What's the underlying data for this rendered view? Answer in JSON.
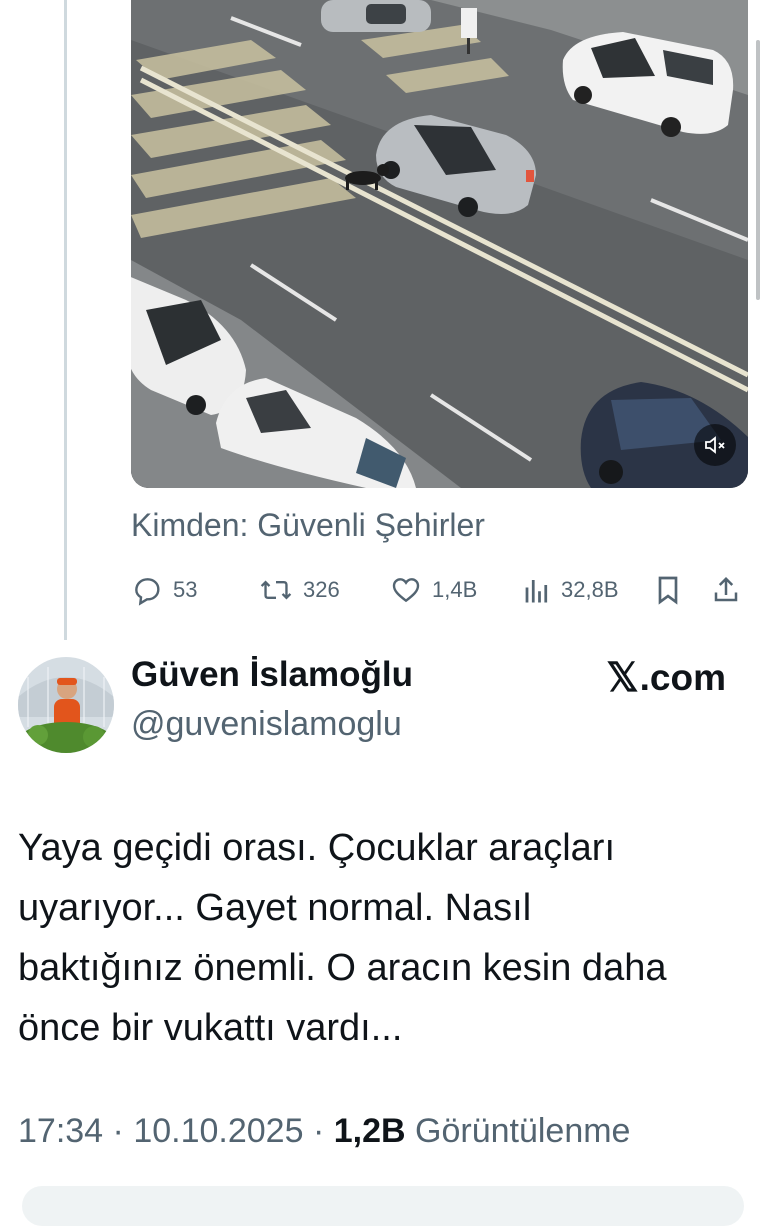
{
  "video": {
    "mute_icon": "volume-muted-icon"
  },
  "tweet_source": {
    "from_text": "Kimden: Güvenli Şehirler"
  },
  "actions": {
    "replies": "53",
    "reposts": "326",
    "likes": "1,4B",
    "views": "32,8B"
  },
  "author": {
    "name": "Güven İslamoğlu",
    "handle": "@guvenislamoglu",
    "site_label": ".com"
  },
  "tweet": {
    "lines": [
      "Yaya geçidi orası. Çocuklar araçları",
      "uyarıyor... Gayet normal. Nasıl",
      "baktığınız önemli. O aracın kesin daha",
      "önce bir vukattı vardı..."
    ],
    "time": "17:34",
    "date": "10.10.2025",
    "views_count": "1,2B",
    "views_label": "Görüntülenme"
  },
  "colors": {
    "text": "#0f1419",
    "muted": "#536471",
    "thread_line": "#cfd9de"
  }
}
